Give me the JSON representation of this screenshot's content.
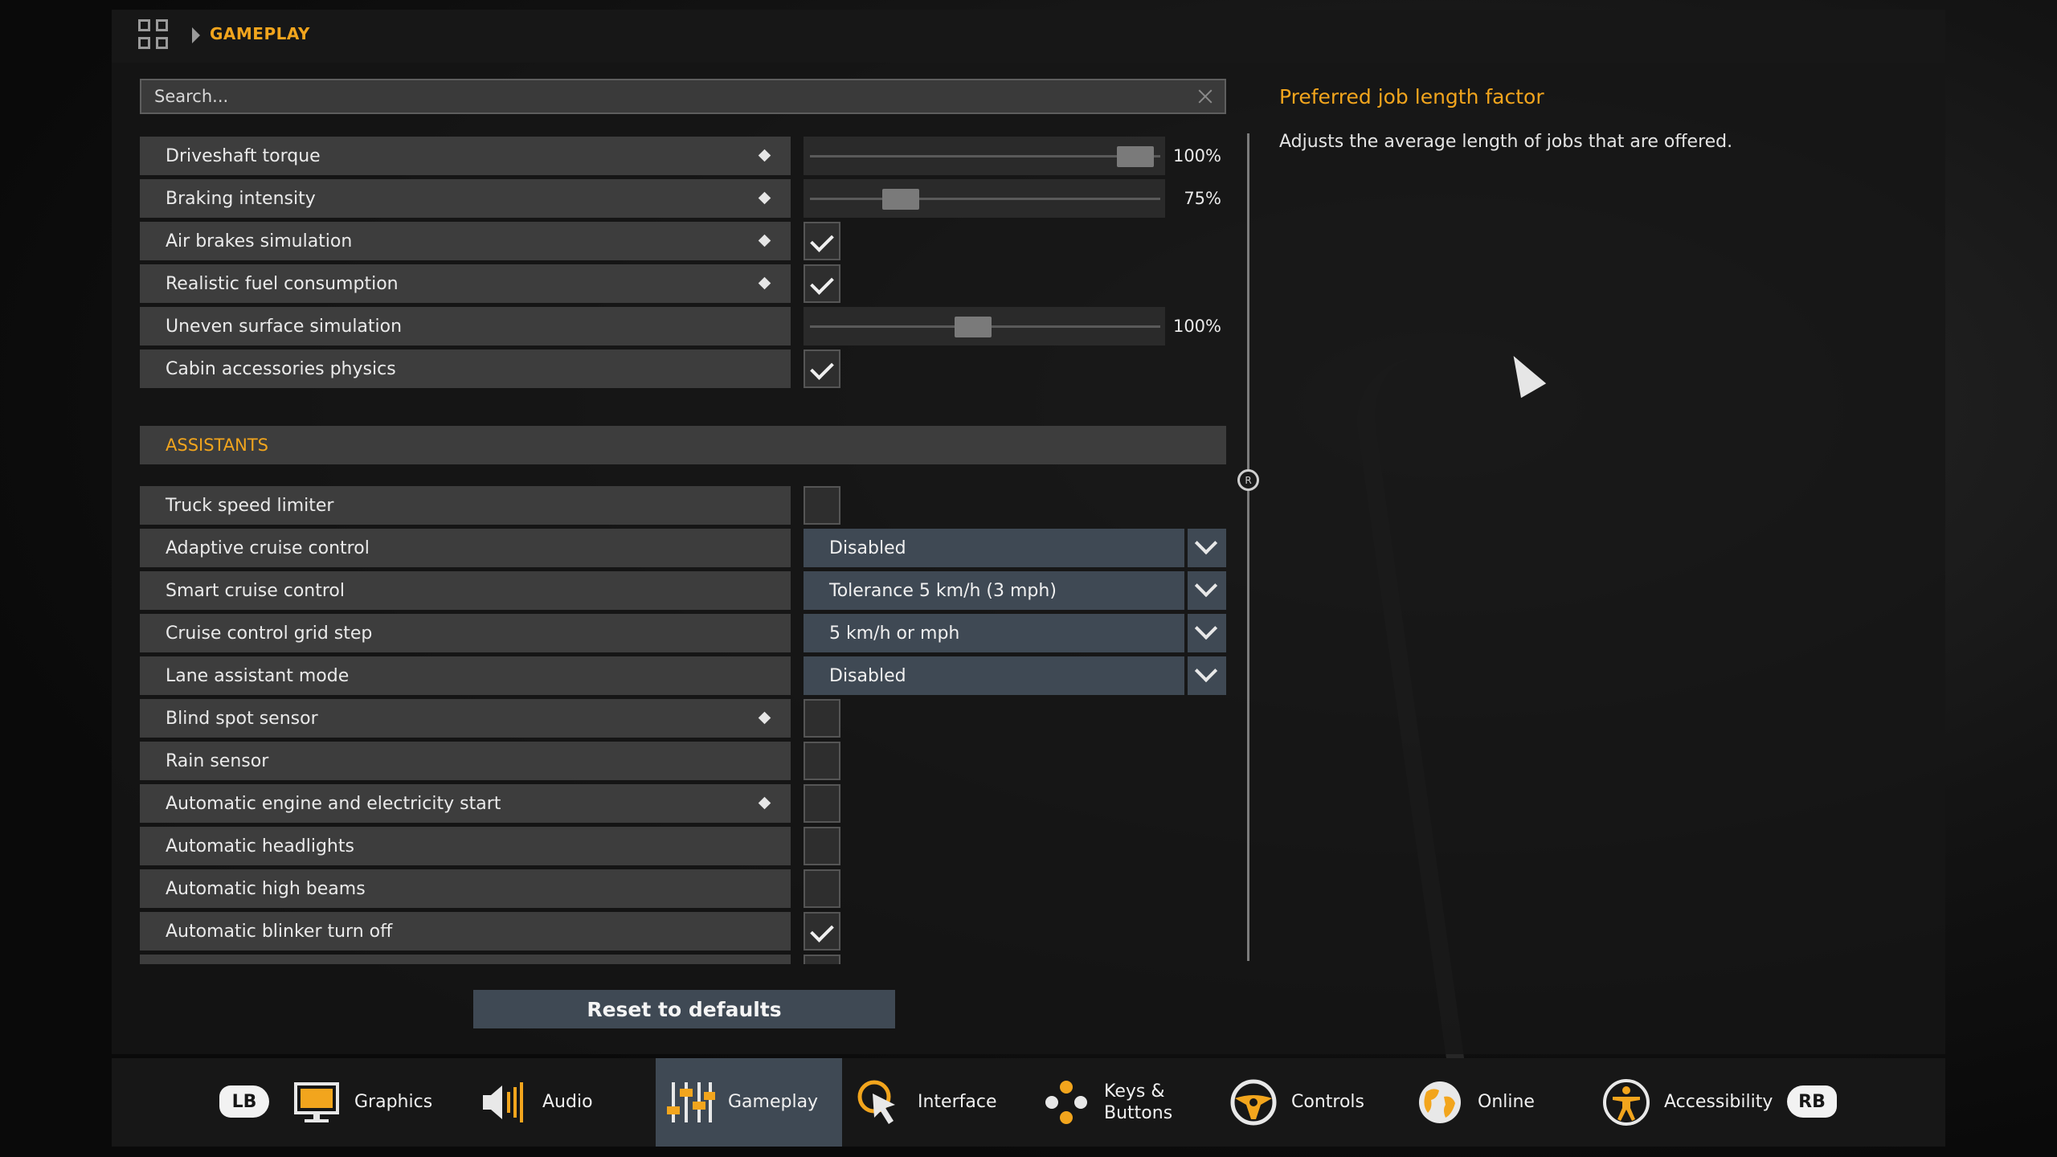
{
  "breadcrumb": {
    "section": "GAMEPLAY"
  },
  "search": {
    "placeholder": "Search..."
  },
  "settings": [
    {
      "label": "Driveshaft torque",
      "type": "slider",
      "value": 1.0,
      "value_text": "100%",
      "modified": true
    },
    {
      "label": "Braking intensity",
      "type": "slider",
      "value": 0.28,
      "value_text": "75%",
      "modified": true
    },
    {
      "label": "Air brakes simulation",
      "type": "checkbox",
      "checked": true,
      "modified": true
    },
    {
      "label": "Realistic fuel consumption",
      "type": "checkbox",
      "checked": true,
      "modified": true
    },
    {
      "label": "Uneven surface simulation",
      "type": "slider",
      "value": 0.5,
      "value_text": "100%",
      "modified": false
    },
    {
      "label": "Cabin accessories physics",
      "type": "checkbox",
      "checked": true,
      "modified": false
    }
  ],
  "assistants": {
    "header": "ASSISTANTS",
    "items": [
      {
        "label": "Truck speed limiter",
        "type": "checkbox",
        "checked": false,
        "modified": false
      },
      {
        "label": "Adaptive cruise control",
        "type": "dropdown",
        "value": "Disabled",
        "modified": false
      },
      {
        "label": "Smart cruise control",
        "type": "dropdown",
        "value": "Tolerance 5 km/h (3 mph)",
        "modified": false
      },
      {
        "label": "Cruise control grid step",
        "type": "dropdown",
        "value": "5 km/h or mph",
        "modified": false
      },
      {
        "label": "Lane assistant mode",
        "type": "dropdown",
        "value": "Disabled",
        "modified": false
      },
      {
        "label": "Blind spot sensor",
        "type": "checkbox",
        "checked": false,
        "modified": true
      },
      {
        "label": "Rain sensor",
        "type": "checkbox",
        "checked": false,
        "modified": false
      },
      {
        "label": "Automatic engine and electricity start",
        "type": "checkbox",
        "checked": false,
        "modified": true
      },
      {
        "label": "Automatic headlights",
        "type": "checkbox",
        "checked": false,
        "modified": false
      },
      {
        "label": "Automatic high beams",
        "type": "checkbox",
        "checked": false,
        "modified": false
      },
      {
        "label": "Automatic blinker turn off",
        "type": "checkbox",
        "checked": true,
        "modified": false
      }
    ]
  },
  "reset_label": "Reset to defaults",
  "description": {
    "title": "Preferred job length factor",
    "text": "Adjusts the average length of jobs that are offered."
  },
  "divider_knob": "R",
  "tabbar": {
    "lb": "LB",
    "rb": "RB",
    "tabs": [
      {
        "label": "Graphics",
        "icon": "monitor-icon"
      },
      {
        "label": "Audio",
        "icon": "speaker-icon"
      },
      {
        "label": "Gameplay",
        "icon": "sliders-icon",
        "active": true
      },
      {
        "label": "Interface",
        "icon": "cursor-click-icon"
      },
      {
        "label": "Keys &",
        "label2": "Buttons",
        "icon": "gamepad-buttons-icon"
      },
      {
        "label": "Controls",
        "icon": "steering-wheel-icon"
      },
      {
        "label": "Online",
        "icon": "globe-icon"
      },
      {
        "label": "Accessibility",
        "icon": "accessibility-icon"
      }
    ]
  },
  "colors": {
    "accent": "#f2a51d",
    "control": "#3f4954",
    "row": "#3d3d3d"
  }
}
